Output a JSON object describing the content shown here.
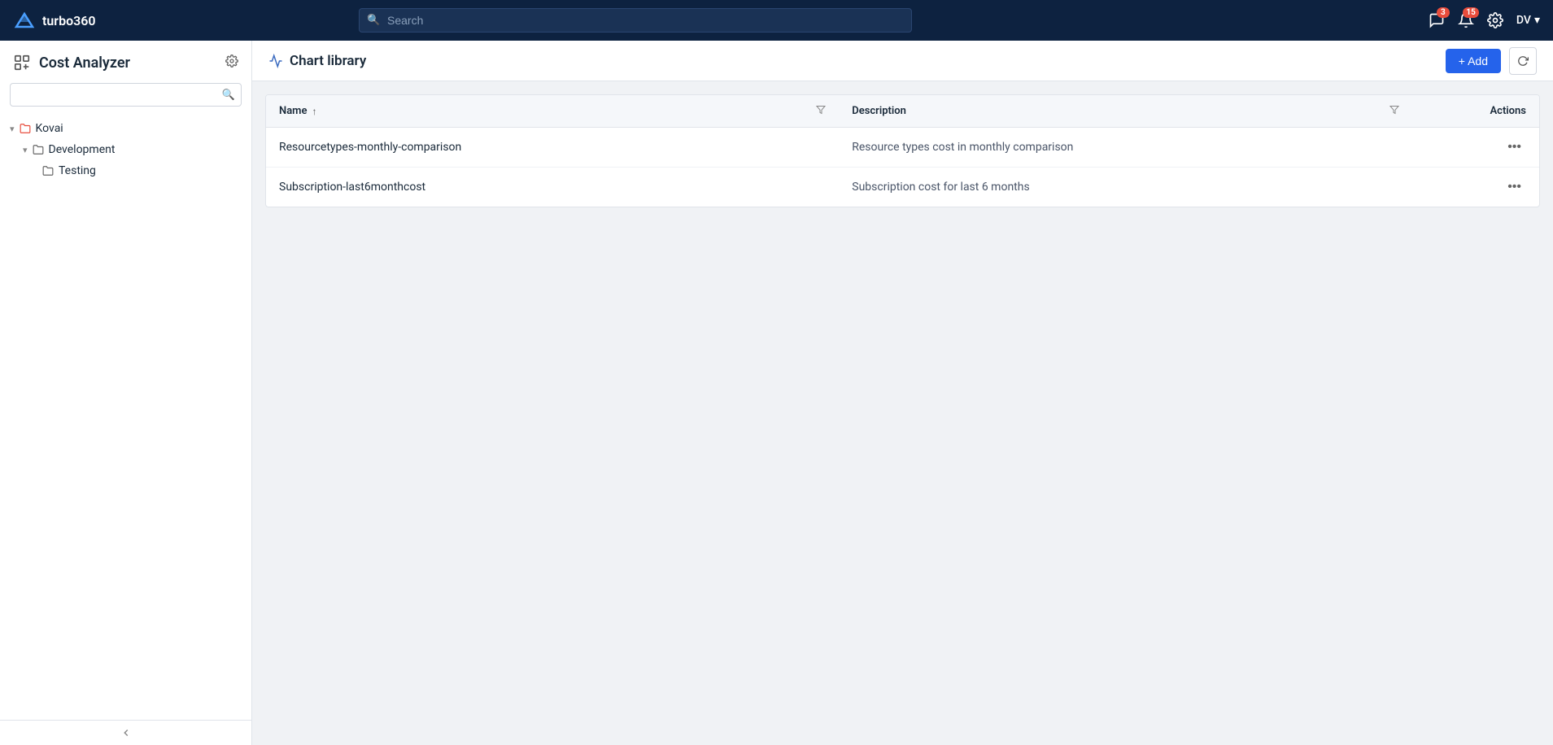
{
  "app": {
    "name": "turbo360"
  },
  "topnav": {
    "search_placeholder": "Search",
    "notifications_badge": "3",
    "alerts_badge": "15",
    "user_label": "DV",
    "chevron_down": "▾"
  },
  "sidebar": {
    "title": "Cost Analyzer",
    "search_placeholder": "",
    "tree": [
      {
        "id": "kovai",
        "label": "Kovai",
        "expanded": true,
        "children": [
          {
            "id": "development",
            "label": "Development",
            "expanded": true,
            "children": [
              {
                "id": "testing",
                "label": "Testing"
              }
            ]
          }
        ]
      }
    ],
    "collapse_btn_title": "Collapse sidebar"
  },
  "main": {
    "header": {
      "title": "Chart library",
      "add_button_label": "+ Add",
      "refresh_title": "Refresh"
    },
    "table": {
      "columns": [
        {
          "key": "name",
          "label": "Name",
          "sortable": true,
          "filterable": true
        },
        {
          "key": "description",
          "label": "Description",
          "filterable": true
        },
        {
          "key": "actions",
          "label": "Actions"
        }
      ],
      "rows": [
        {
          "name": "Resourcetypes-monthly-comparison",
          "description": "Resource types cost in monthly comparison"
        },
        {
          "name": "Subscription-last6monthcost",
          "description": "Subscription cost for last 6 months"
        }
      ]
    }
  }
}
